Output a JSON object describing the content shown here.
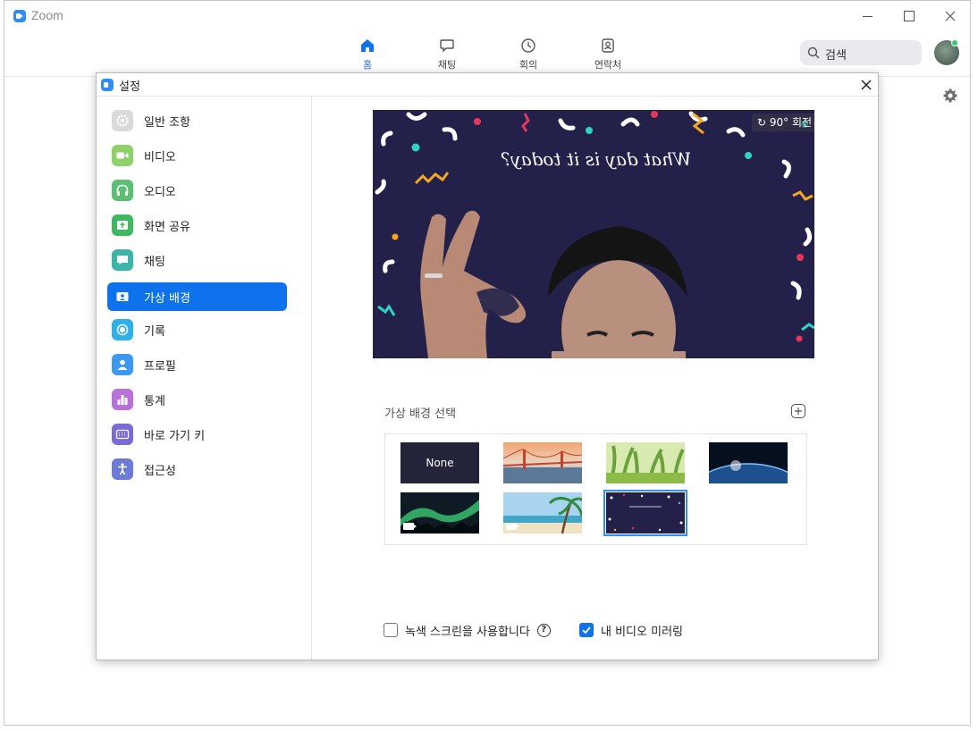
{
  "window": {
    "title": "Zoom"
  },
  "nav": {
    "tabs": [
      {
        "label": "홈",
        "icon": "home-icon",
        "active": true
      },
      {
        "label": "채팅",
        "icon": "chat-icon",
        "active": false
      },
      {
        "label": "회의",
        "icon": "clock-icon",
        "active": false
      },
      {
        "label": "연락처",
        "icon": "contacts-icon",
        "active": false
      }
    ],
    "search_placeholder": "검색"
  },
  "settings": {
    "title": "설정",
    "sidebar": [
      {
        "label": "일반 조항",
        "icon": "gear-icon",
        "color": "#d9d9d9"
      },
      {
        "label": "비디오",
        "icon": "video-icon",
        "color": "#8fd16a"
      },
      {
        "label": "오디오",
        "icon": "headphones-icon",
        "color": "#5cbf73"
      },
      {
        "label": "화면 공유",
        "icon": "share-screen-icon",
        "color": "#3fb860"
      },
      {
        "label": "채팅",
        "icon": "chat-icon",
        "color": "#3ab5a8"
      },
      {
        "label": "가상 배경",
        "icon": "virtual-background-icon",
        "color": "#ffffff",
        "active": true
      },
      {
        "label": "기록",
        "icon": "record-icon",
        "color": "#2fb0e6"
      },
      {
        "label": "프로필",
        "icon": "profile-icon",
        "color": "#3d99f0"
      },
      {
        "label": "통계",
        "icon": "statistics-icon",
        "color": "#b871d9"
      },
      {
        "label": "바로 가기 키",
        "icon": "keyboard-icon",
        "color": "#7c6ad8"
      },
      {
        "label": "접근성",
        "icon": "accessibility-icon",
        "color": "#6c7ad8"
      }
    ],
    "preview": {
      "overlay_text": "What day is it today?",
      "rotate_label": "90° 회전"
    },
    "background_section": {
      "label": "가상 배경 선택",
      "thumbnails": [
        {
          "name": "none",
          "label": "None",
          "video": false
        },
        {
          "name": "golden-gate-bridge",
          "video": false
        },
        {
          "name": "grass",
          "video": false
        },
        {
          "name": "earth-from-space",
          "video": false
        },
        {
          "name": "aurora",
          "video": true
        },
        {
          "name": "beach",
          "video": true
        },
        {
          "name": "what-day-confetti",
          "video": false,
          "selected": true
        }
      ]
    },
    "options": {
      "green_screen_label": "녹색 스크린을 사용합니다",
      "green_screen_checked": false,
      "mirror_label": "내 비디오 미러링",
      "mirror_checked": true
    }
  }
}
